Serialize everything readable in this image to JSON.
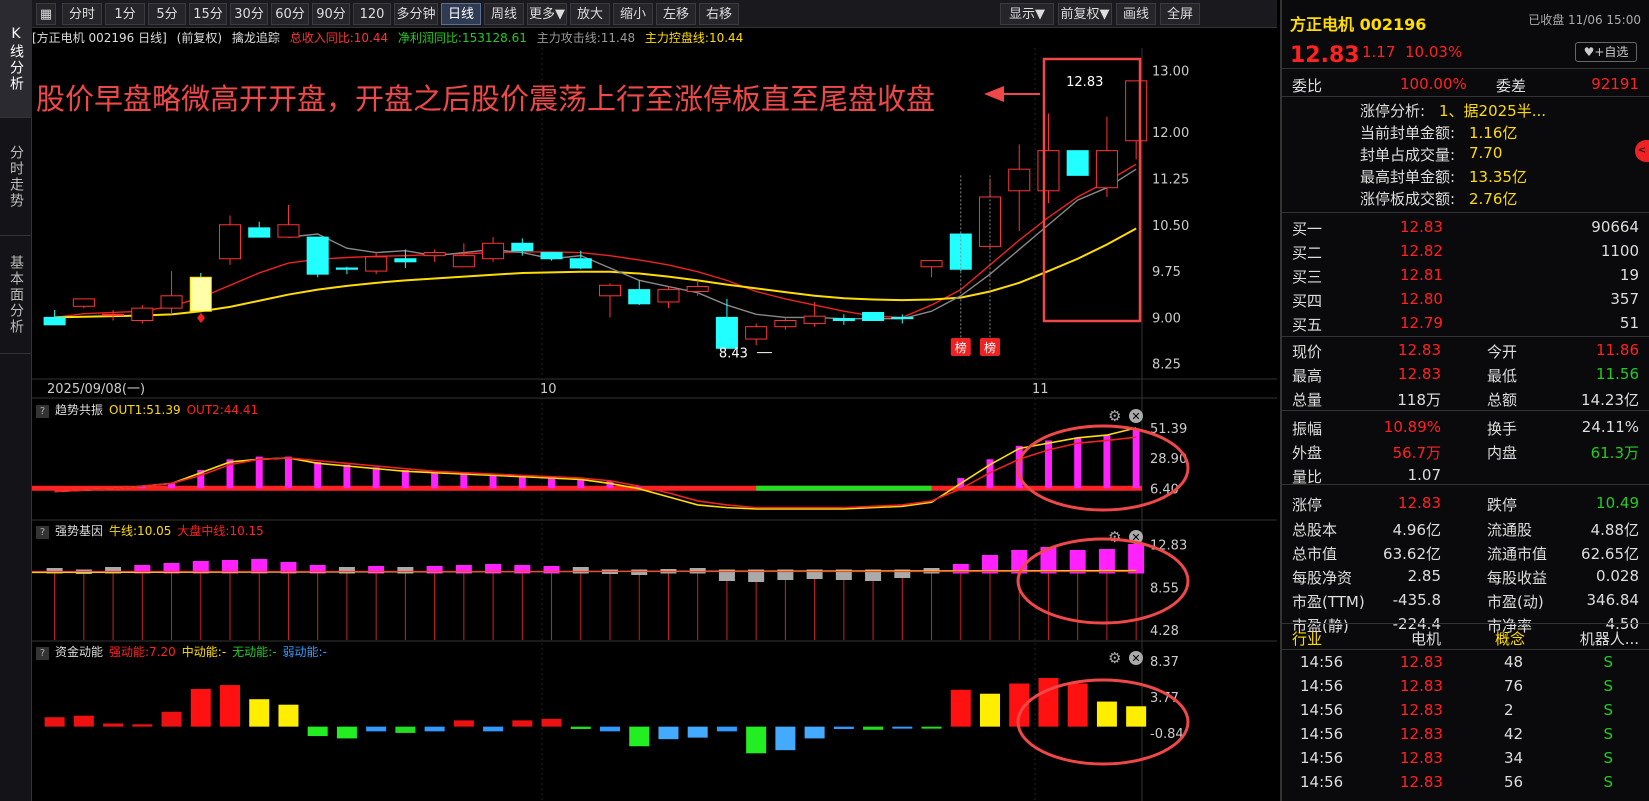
{
  "sidetabs": [
    "K线分析",
    "分时走势",
    "基本面分析"
  ],
  "toolbar": {
    "periods": [
      "分时",
      "1分",
      "5分",
      "15分",
      "30分",
      "60分",
      "90分",
      "120分",
      "多分钟",
      "日线",
      "周线",
      "更多▼",
      "放大",
      "缩小",
      "左移",
      "右移"
    ],
    "active": "日线",
    "right": [
      "显示▼",
      "前复权▼",
      "画线",
      "全屏"
    ]
  },
  "main_info": {
    "title": "[方正电机 002196 日线]",
    "adjust": "(前复权)",
    "indicator": "擒龙追踪",
    "l1": "总收入同比:10.44",
    "l2": "净利润同比:153128.61",
    "l3": "主力攻击线:11.48",
    "l4": "主力控盘线:10.44"
  },
  "annotation": "股价早盘略微高开开盘，开盘之后股价震荡上行至涨停板直至尾盘收盘",
  "sub1": {
    "name": "趋势共振",
    "a": "OUT1:51.39",
    "b": "OUT2:44.41"
  },
  "sub2": {
    "name": "强势基因",
    "a": "牛线:10.05",
    "b": "大盘中线:10.15"
  },
  "sub3": {
    "name": "资金动能",
    "a": "强动能:7.20",
    "b": "中动能:-",
    "c": "无动能:-",
    "d": "弱动能:-"
  },
  "chart_data": [
    {
      "type": "candlestick",
      "title": "方正电机 002196 日线",
      "y_ticks": [
        13.0,
        12.0,
        11.25,
        10.5,
        9.75,
        9.0,
        8.25
      ],
      "x_labels": [
        "2025/09/08(一)",
        "10",
        "11"
      ],
      "ohlc": [
        [
          9.0,
          9.12,
          8.88,
          8.88
        ],
        [
          9.18,
          9.3,
          9.15,
          9.3
        ],
        [
          9.05,
          9.12,
          8.95,
          9.05
        ],
        [
          8.95,
          9.2,
          8.9,
          9.15
        ],
        [
          9.15,
          9.75,
          9.05,
          9.35
        ],
        [
          9.65,
          9.72,
          9.1,
          9.1
        ],
        [
          9.95,
          10.65,
          9.85,
          10.5
        ],
        [
          10.45,
          10.55,
          10.3,
          10.3
        ],
        [
          10.3,
          10.82,
          10.3,
          10.5
        ],
        [
          10.3,
          10.3,
          9.65,
          9.7
        ],
        [
          9.8,
          9.82,
          9.7,
          9.78
        ],
        [
          9.75,
          10.05,
          9.7,
          9.98
        ],
        [
          9.95,
          10.1,
          9.8,
          9.9
        ],
        [
          10.0,
          10.1,
          9.9,
          10.05
        ],
        [
          9.82,
          10.2,
          9.82,
          10.0
        ],
        [
          9.95,
          10.3,
          9.9,
          10.2
        ],
        [
          10.2,
          10.28,
          10.0,
          10.08
        ],
        [
          10.05,
          10.05,
          9.92,
          9.95
        ],
        [
          9.95,
          10.08,
          9.78,
          9.8
        ],
        [
          9.35,
          9.55,
          9.0,
          9.52
        ],
        [
          9.45,
          9.6,
          9.2,
          9.22
        ],
        [
          9.25,
          9.5,
          9.15,
          9.45
        ],
        [
          9.42,
          9.6,
          9.35,
          9.5
        ],
        [
          9.0,
          9.3,
          8.5,
          8.5
        ],
        [
          8.65,
          8.9,
          8.55,
          8.85
        ],
        [
          8.85,
          9.0,
          8.8,
          8.95
        ],
        [
          8.9,
          9.25,
          8.85,
          9.02
        ],
        [
          8.98,
          9.05,
          8.88,
          8.95
        ],
        [
          9.08,
          9.08,
          8.95,
          8.95
        ],
        [
          9.0,
          9.05,
          8.9,
          8.98
        ],
        [
          9.82,
          9.92,
          9.65,
          9.92
        ],
        [
          10.35,
          10.35,
          9.75,
          9.78
        ],
        [
          10.15,
          11.25,
          10.1,
          10.95
        ],
        [
          11.05,
          11.8,
          10.4,
          11.4
        ],
        [
          11.05,
          12.3,
          10.85,
          11.7
        ],
        [
          11.7,
          11.7,
          11.3,
          11.3
        ],
        [
          11.1,
          12.25,
          10.95,
          11.7
        ],
        [
          11.86,
          12.83,
          11.56,
          12.83
        ]
      ],
      "series": [
        {
          "name": "主力攻击线",
          "values": [
            9.0,
            9.06,
            9.08,
            9.1,
            9.18,
            9.32,
            9.52,
            9.72,
            9.88,
            9.94,
            9.97,
            9.99,
            10.0,
            10.02,
            10.03,
            10.05,
            10.06,
            10.06,
            10.05,
            10.0,
            9.93,
            9.85,
            9.74,
            9.6,
            9.42,
            9.3,
            9.2,
            9.1,
            9.02,
            9.0,
            9.2,
            9.45,
            9.85,
            10.25,
            10.62,
            10.95,
            11.2,
            11.48
          ]
        },
        {
          "name": "主力控盘线",
          "values": [
            9.0,
            9.01,
            9.02,
            9.03,
            9.05,
            9.1,
            9.17,
            9.27,
            9.37,
            9.45,
            9.51,
            9.56,
            9.6,
            9.63,
            9.66,
            9.69,
            9.72,
            9.73,
            9.74,
            9.74,
            9.71,
            9.66,
            9.6,
            9.53,
            9.47,
            9.41,
            9.35,
            9.31,
            9.29,
            9.28,
            9.29,
            9.32,
            9.42,
            9.56,
            9.75,
            9.95,
            10.18,
            10.44
          ]
        },
        {
          "name": "gray",
          "values": [
            null,
            null,
            null,
            null,
            null,
            null,
            null,
            null,
            10.3,
            10.35,
            10.12,
            10.05,
            10.08,
            10.0,
            10.05,
            10.1,
            10.05,
            9.95,
            10.0,
            9.8,
            9.6,
            9.5,
            9.4,
            9.2,
            9.05,
            9.0,
            9.0,
            8.98,
            8.98,
            8.98,
            9.1,
            9.35,
            9.7,
            10.1,
            10.5,
            10.9,
            11.1,
            11.4
          ]
        }
      ],
      "marks": {
        "high_label": "12.83",
        "low_label": "8.43",
        "badge": "榜"
      }
    },
    {
      "type": "bar+line",
      "title": "趋势共振",
      "y_ticks": [
        "51.39",
        "28.90",
        "6.40"
      ],
      "values": [
        6,
        6,
        7,
        8,
        10,
        20,
        28,
        30,
        30,
        26,
        24,
        22,
        20,
        19,
        18,
        17,
        16,
        15,
        14,
        12,
        8,
        5,
        3,
        2,
        1,
        1,
        1,
        1,
        1,
        2,
        4,
        14,
        28,
        38,
        42,
        44,
        46,
        51
      ],
      "series": [
        {
          "name": "OUT1",
          "values": [
            4,
            5,
            6,
            8,
            10,
            18,
            26,
            28,
            29,
            25,
            23,
            21,
            19,
            18,
            17,
            16,
            15,
            14,
            13,
            10,
            6,
            0,
            -6,
            -8,
            -9,
            -9,
            -9,
            -9,
            -8,
            -7,
            -4,
            10,
            24,
            36,
            40,
            44,
            46,
            51.39
          ]
        },
        {
          "name": "OUT2",
          "values": [
            4,
            5,
            6,
            8,
            10,
            16,
            24,
            28,
            29,
            27,
            25,
            23,
            21,
            19,
            18,
            17,
            16,
            15,
            14,
            12,
            8,
            3,
            -3,
            -6,
            -8,
            -8,
            -8,
            -8,
            -7,
            -6,
            -3,
            6,
            18,
            28,
            35,
            40,
            42,
            44.41
          ]
        }
      ]
    },
    {
      "type": "bar+line",
      "title": "强势基因",
      "y_ticks": [
        "12.83",
        "8.55",
        "4.28"
      ],
      "bars": [
        10.2,
        10.0,
        10.3,
        10.5,
        10.7,
        10.9,
        11.0,
        11.1,
        10.8,
        10.5,
        10.3,
        10.4,
        10.3,
        10.4,
        10.5,
        10.6,
        10.5,
        10.4,
        10.3,
        10.0,
        9.9,
        10.1,
        10.2,
        9.3,
        9.2,
        9.4,
        9.5,
        9.4,
        9.3,
        9.6,
        10.2,
        10.6,
        11.5,
        12.0,
        12.3,
        12.0,
        12.1,
        12.6
      ],
      "series": [
        {
          "name": "牛线",
          "value": 10.05
        },
        {
          "name": "大盘中线",
          "value": 10.15
        }
      ]
    },
    {
      "type": "bar",
      "title": "资金动能",
      "y_ticks": [
        "8.37",
        "3.77",
        "-0.84"
      ],
      "values": [
        1.2,
        1.4,
        0.4,
        0.3,
        1.9,
        4.8,
        5.3,
        3.5,
        2.8,
        -1.2,
        -1.5,
        -0.6,
        -0.8,
        -0.6,
        0.8,
        -0.6,
        0.8,
        1.0,
        -0.3,
        -0.6,
        -2.5,
        -1.6,
        -1.4,
        -0.6,
        -3.4,
        -3.0,
        -1.5,
        -0.3,
        -0.4,
        -0.2,
        -0.1,
        4.7,
        4.2,
        5.5,
        6.2,
        5.5,
        3.2,
        2.6,
        5.5
      ]
    }
  ],
  "quote": {
    "name": "方正电机 002196",
    "status": "已收盘 11/06 15:00",
    "price": "12.83",
    "chg": "1.17",
    "pct": "10.03%",
    "fav": "+自选",
    "weibi_label": "委比",
    "weibi": "100.00%",
    "weicha_label": "委差",
    "weicha": "92191",
    "limit_info": [
      [
        "涨停分析:",
        "1、据2025半..."
      ],
      [
        "当前封单金额:",
        "1.16亿"
      ],
      [
        "封单占成交量:",
        "7.70"
      ],
      [
        "最高封单金额:",
        "13.35亿"
      ],
      [
        "涨停板成交额:",
        "2.76亿"
      ]
    ],
    "bids": [
      [
        "买一",
        "12.83",
        "90664"
      ],
      [
        "买二",
        "12.82",
        "1100"
      ],
      [
        "买三",
        "12.81",
        "19"
      ],
      [
        "买四",
        "12.80",
        "357"
      ],
      [
        "买五",
        "12.79",
        "51"
      ]
    ],
    "stats": [
      [
        "现价",
        "12.83",
        "今开",
        "11.86"
      ],
      [
        "最高",
        "12.83",
        "最低",
        "11.56"
      ],
      [
        "总量",
        "118万",
        "总额",
        "14.23亿"
      ],
      [
        "振幅",
        "10.89%",
        "换手",
        "24.11%"
      ],
      [
        "外盘",
        "56.7万",
        "内盘",
        "61.3万"
      ],
      [
        "量比",
        "1.07",
        "",
        ""
      ],
      [
        "涨停",
        "12.83",
        "跌停",
        "10.49"
      ],
      [
        "总股本",
        "4.96亿",
        "流通股",
        "4.88亿"
      ],
      [
        "总市值",
        "63.62亿",
        "流通市值",
        "62.65亿"
      ],
      [
        "每股净资",
        "2.85",
        "每股收益",
        "0.028"
      ],
      [
        "市盈(TTM)",
        "-435.8",
        "市盈(动)",
        "346.84"
      ],
      [
        "市盈(静)",
        "-224.4",
        "市净率",
        "4.50"
      ]
    ],
    "industry": [
      "行业",
      "电机",
      "概念",
      "机器人..."
    ],
    "ticks": [
      [
        "14:56",
        "12.83",
        "48",
        "S"
      ],
      [
        "14:56",
        "12.83",
        "76",
        "S"
      ],
      [
        "14:56",
        "12.83",
        "2",
        "S"
      ],
      [
        "14:56",
        "12.83",
        "42",
        "S"
      ],
      [
        "14:56",
        "12.83",
        "34",
        "S"
      ],
      [
        "14:56",
        "12.83",
        "56",
        "S"
      ]
    ]
  }
}
